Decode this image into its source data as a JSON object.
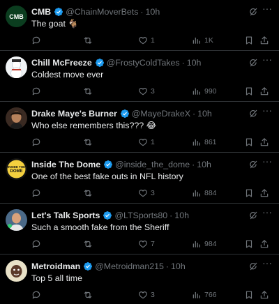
{
  "tweets": [
    {
      "name": "CMB",
      "handle": "@ChainMoverBets",
      "time": "10h",
      "text": "The goat 🐐",
      "avatar_label": "CMB",
      "replies": "",
      "reposts": "",
      "likes": "1",
      "views": "1K"
    },
    {
      "name": "Chill McFreeze",
      "handle": "@FrostyColdTakes",
      "time": "10h",
      "text": "Coldest move ever",
      "replies": "",
      "reposts": "",
      "likes": "3",
      "views": "990"
    },
    {
      "name": "Drake Maye's Burner",
      "handle": "@MayeDrakeX",
      "time": "10h",
      "text": "Who else remembers this??? 😂",
      "replies": "",
      "reposts": "",
      "likes": "1",
      "views": "861"
    },
    {
      "name": "Inside The Dome",
      "handle": "@inside_the_dome",
      "time": "10h",
      "text": "One of the best fake outs in NFL history",
      "avatar_label": "INSIDE THE DOME",
      "replies": "",
      "reposts": "",
      "likes": "3",
      "views": "884"
    },
    {
      "name": "Let's Talk Sports",
      "handle": "@LTSports80",
      "time": "10h",
      "text": "Such a smooth fake from the Sheriff",
      "replies": "",
      "reposts": "",
      "likes": "7",
      "views": "984"
    },
    {
      "name": "Metroidman",
      "handle": "@Metroidman215",
      "time": "10h",
      "text": "Top 5 all time",
      "replies": "",
      "reposts": "",
      "likes": "3",
      "views": "766"
    }
  ],
  "ui": {
    "separator": "·",
    "more_glyph": "···"
  },
  "colors": {
    "background": "#000000",
    "text_primary": "#e7e9ea",
    "text_secondary": "#71767b",
    "verified_badge": "#1d9bf0",
    "divider": "#2f3336"
  },
  "icons": [
    "verified-badge-icon",
    "grok-icon",
    "more-icon",
    "reply-icon",
    "repost-icon",
    "like-icon",
    "views-icon",
    "bookmark-icon",
    "share-icon"
  ]
}
